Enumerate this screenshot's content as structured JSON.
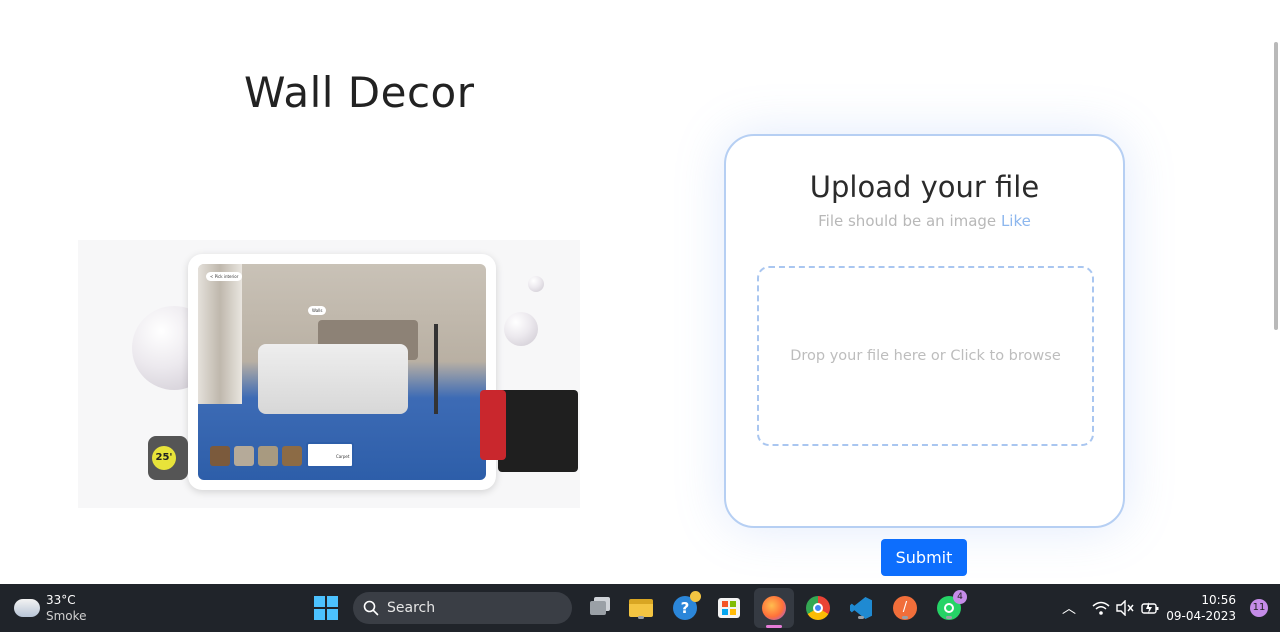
{
  "page": {
    "title": "Wall Decor"
  },
  "illustration": {
    "tape_label": "25'",
    "app_chip_back": "< Pick interior",
    "app_chip_walls": "Walls",
    "app_chip_carpet": "Carpet"
  },
  "upload": {
    "title": "Upload your file",
    "subtitle": "File should be an image",
    "subtitle_link": "Like",
    "dropzone_text": "Drop your file here or Click to browse"
  },
  "submit_label": "Submit",
  "taskbar": {
    "weather": {
      "temp": "33°C",
      "condition": "Smoke"
    },
    "search_placeholder": "Search",
    "apps": [
      "start-icon",
      "search",
      "task-view-icon",
      "file-explorer-icon",
      "help-icon",
      "microsoft-store-icon",
      "firefox-icon",
      "chrome-icon",
      "vscode-icon",
      "brave-icon",
      "whatsapp-icon"
    ],
    "whatsapp_badge": "4",
    "time": "10:56",
    "date": "09-04-2023",
    "notification_count": "11"
  },
  "colors": {
    "accent": "#0d6efd",
    "card_border": "#b6cff3",
    "dropzone_border": "#a9c6f0",
    "taskbar_bg": "#20242a"
  }
}
